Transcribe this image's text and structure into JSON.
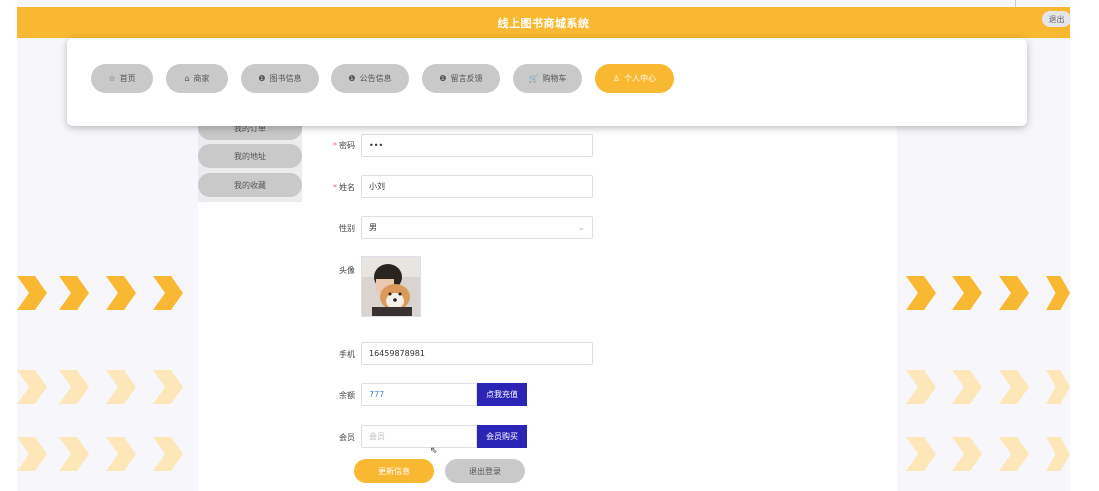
{
  "header": {
    "title": "线上图书商城系统",
    "logout_label": "退出"
  },
  "nav": {
    "items": [
      {
        "icon": "star-icon",
        "glyph": "☆",
        "label": "首页"
      },
      {
        "icon": "home-icon",
        "glyph": "⌂",
        "label": "商家"
      },
      {
        "icon": "info-icon",
        "glyph": "❶",
        "label": "图书信息"
      },
      {
        "icon": "info-icon",
        "glyph": "❶",
        "label": "公告信息"
      },
      {
        "icon": "info-icon",
        "glyph": "❶",
        "label": "留言反馈"
      },
      {
        "icon": "cart-icon",
        "glyph": "🛒",
        "label": "购物车"
      },
      {
        "icon": "user-icon",
        "glyph": "♙",
        "label": "个人中心"
      }
    ],
    "active_index": 6
  },
  "sidebar": {
    "items": [
      {
        "label": "我的订单"
      },
      {
        "label": "我的地址"
      },
      {
        "label": "我的收藏"
      }
    ]
  },
  "form": {
    "password": {
      "label": "密码",
      "value": "•••",
      "required": true
    },
    "name": {
      "label": "姓名",
      "value": "小刘",
      "required": true
    },
    "gender": {
      "label": "性别",
      "value": "男"
    },
    "avatar": {
      "label": "头像"
    },
    "phone": {
      "label": "手机",
      "value": "16459878981"
    },
    "balance": {
      "label": "余额",
      "value": "777",
      "button": "点我充值"
    },
    "member": {
      "label": "会员",
      "placeholder": "会员",
      "button": "会员购买"
    }
  },
  "actions": {
    "update": "更新信息",
    "logout": "退出登录"
  },
  "colors": {
    "accent": "#f9b831",
    "primary_button": "#2b25b7",
    "chevron_light": "#fde7b8"
  }
}
